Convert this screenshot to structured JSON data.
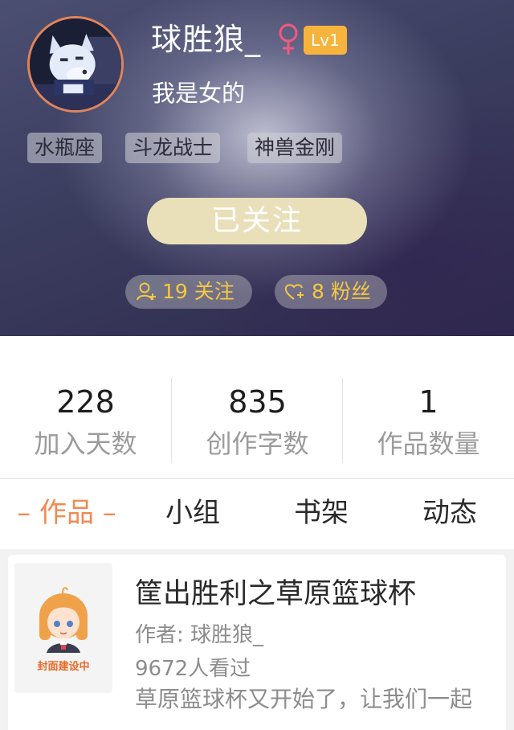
{
  "profile": {
    "username": "球胜狼_",
    "level": "Lv1",
    "bio": "我是女的",
    "tags": [
      "水瓶座",
      "斗龙战士",
      "神兽金刚"
    ],
    "follow_button": "已关注",
    "following_text": "19 关注",
    "followers_text": "8 粉丝"
  },
  "stats": [
    {
      "value": "228",
      "label": "加入天数"
    },
    {
      "value": "835",
      "label": "创作字数"
    },
    {
      "value": "1",
      "label": "作品数量"
    }
  ],
  "tabs": [
    "– 作品 –",
    "小组",
    "书架",
    "动态"
  ],
  "work": {
    "title": "筐出胜利之草原篮球杯",
    "author": "作者: 球胜狼_",
    "views": "9672人看过",
    "description": "草原篮球杯又开始了，让我们一起",
    "cover_label": "封面建设中"
  },
  "colors": {
    "accent": "#f08b52",
    "level_badge": "#f7b43c",
    "follow_button": "#e9dfb9",
    "stat_pill_text": "#f5c842"
  }
}
